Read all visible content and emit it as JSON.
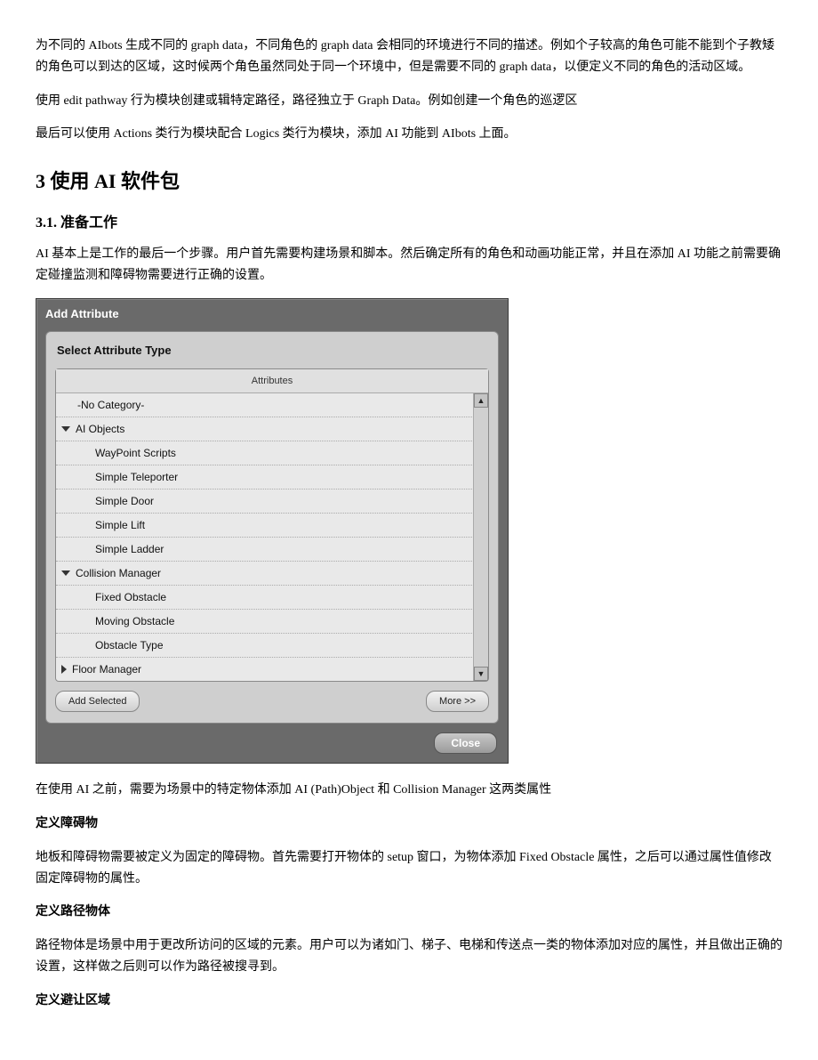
{
  "paragraphs": {
    "p1": "为不同的 AIbots 生成不同的 graph data，不同角色的 graph data 会相同的环境进行不同的描述。例如个子较高的角色可能不能到个子教矮的角色可以到达的区域，这时候两个角色虽然同处于同一个环境中，但是需要不同的 graph data，以便定义不同的角色的活动区域。",
    "p2": "使用 edit pathway 行为模块创建或辑特定路径，路径独立于 Graph Data。例如创建一个角色的巡逻区",
    "p3": "最后可以使用 Actions 类行为模块配合 Logics 类行为模块，添加 AI 功能到 AIbots 上面。",
    "h2": "3  使用 AI 软件包",
    "h3": "3.1.  准备工作",
    "p4": "AI 基本上是工作的最后一个步骤。用户首先需要构建场景和脚本。然后确定所有的角色和动画功能正常，并且在添加 AI 功能之前需要确定碰撞监测和障碍物需要进行正确的设置。",
    "p5": "在使用 AI 之前，需要为场景中的特定物体添加 AI (Path)Object 和 Collision Manager 这两类属性",
    "sub1": "定义障碍物",
    "p6": "地板和障碍物需要被定义为固定的障碍物。首先需要打开物体的 setup 窗口，为物体添加 Fixed Obstacle 属性，之后可以通过属性值修改固定障碍物的属性。",
    "sub2": "定义路径物体",
    "p7": "路径物体是场景中用于更改所访问的区域的元素。用户可以为诸如门、梯子、电梯和传送点一类的物体添加对应的属性，并且做出正确的设置，这样做之后则可以作为路径被搜寻到。",
    "sub3": "定义避让区域"
  },
  "dialog": {
    "title": "Add Attribute",
    "panel_title": "Select Attribute Type",
    "list_header": "Attributes",
    "rows": [
      {
        "label": "-No Category-",
        "indent": 1,
        "arrow": "none"
      },
      {
        "label": "AI Objects",
        "indent": 0,
        "arrow": "down"
      },
      {
        "label": "WayPoint Scripts",
        "indent": 2,
        "arrow": "none"
      },
      {
        "label": "Simple Teleporter",
        "indent": 2,
        "arrow": "none"
      },
      {
        "label": "Simple Door",
        "indent": 2,
        "arrow": "none"
      },
      {
        "label": "Simple Lift",
        "indent": 2,
        "arrow": "none"
      },
      {
        "label": "Simple Ladder",
        "indent": 2,
        "arrow": "none"
      },
      {
        "label": "Collision Manager",
        "indent": 0,
        "arrow": "down"
      },
      {
        "label": "Fixed Obstacle",
        "indent": 2,
        "arrow": "none"
      },
      {
        "label": "Moving Obstacle",
        "indent": 2,
        "arrow": "none"
      },
      {
        "label": "Obstacle Type",
        "indent": 2,
        "arrow": "none"
      },
      {
        "label": "Floor Manager",
        "indent": 0,
        "arrow": "right"
      }
    ],
    "add_selected": "Add Selected",
    "more": "More  >>",
    "close": "Close"
  }
}
